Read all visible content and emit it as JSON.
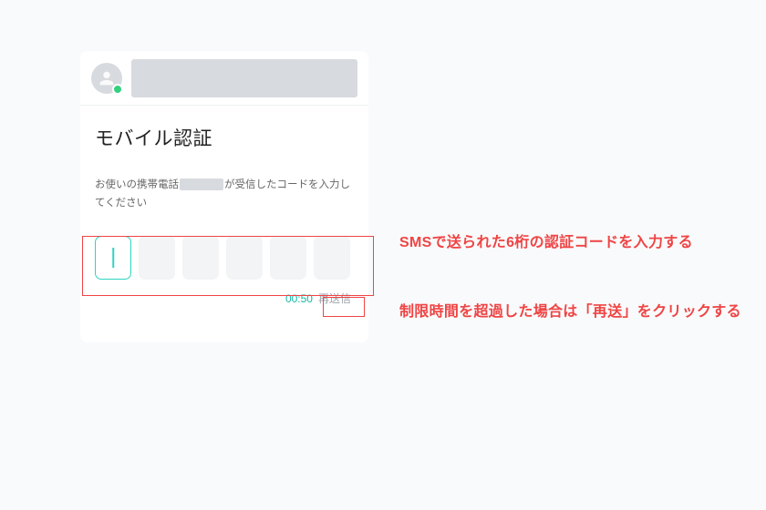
{
  "screen": {
    "title": "モバイル認証",
    "instruction_before": "お使いの携帯電話",
    "instruction_after": "が受信したコードを入力してください",
    "timer": "00:50",
    "resend_label": "再送信"
  },
  "annotations": {
    "code_input": "SMSで送られた6桁の認証コードを入力する",
    "resend": "制限時間を超過した場合は「再送」をクリックする"
  }
}
